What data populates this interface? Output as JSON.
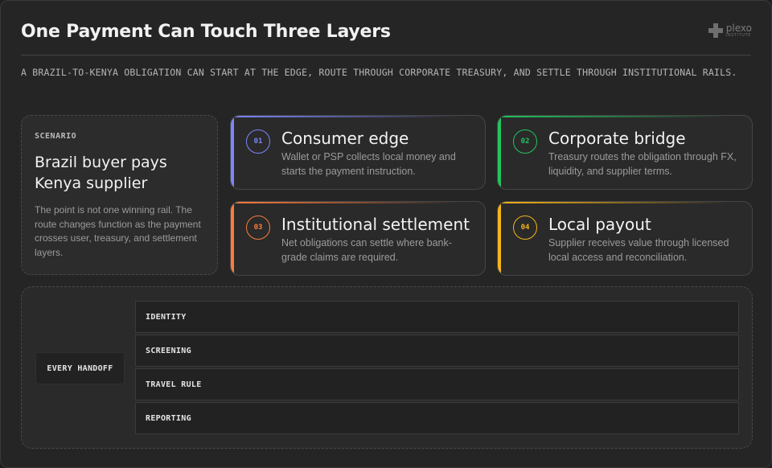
{
  "header": {
    "title": "One Payment Can Touch Three Layers",
    "subtitle": "A BRAZIL-TO-KENYA OBLIGATION CAN START AT THE EDGE, ROUTE THROUGH CORPORATE TREASURY, AND SETTLE THROUGH INSTITUTIONAL RAILS."
  },
  "logo": {
    "name": "plexo",
    "sub": "INSTITUTE",
    "icon": "plus-cross-icon"
  },
  "scenario": {
    "kicker": "SCENARIO",
    "title": "Brazil buyer pays Kenya supplier",
    "text": "The point is not one winning rail. The route changes function as the payment crosses user, treasury, and settlement layers."
  },
  "cards": [
    {
      "num": "01",
      "title": "Consumer edge",
      "text": "Wallet or PSP collects local money and starts the payment instruction.",
      "accent": "#7c86ff"
    },
    {
      "num": "02",
      "title": "Corporate bridge",
      "text": "Treasury routes the obligation through FX, liquidity, and supplier terms.",
      "accent": "#22c55e"
    },
    {
      "num": "03",
      "title": "Institutional settlement",
      "text": "Net obligations can settle where bank-grade claims are required.",
      "accent": "#f97c3c"
    },
    {
      "num": "04",
      "title": "Local payout",
      "text": "Supplier receives value through licensed local access and reconciliation.",
      "accent": "#f5b418"
    }
  ],
  "handoff": {
    "label": "EVERY HANDOFF",
    "rows": [
      "IDENTITY",
      "SCREENING",
      "TRAVEL RULE",
      "REPORTING"
    ]
  }
}
